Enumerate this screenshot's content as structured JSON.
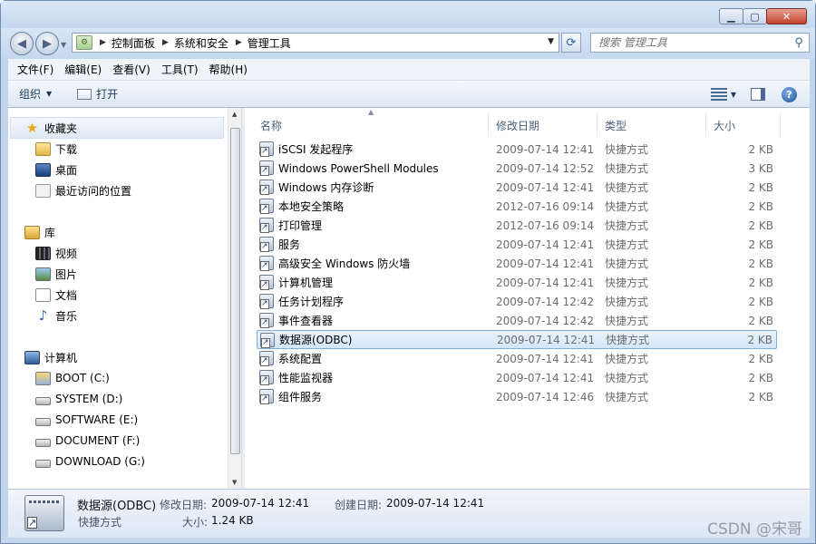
{
  "breadcrumb": [
    "控制面板",
    "系统和安全",
    "管理工具"
  ],
  "search": {
    "placeholder": "搜索 管理工具"
  },
  "menu": [
    "文件(F)",
    "编辑(E)",
    "查看(V)",
    "工具(T)",
    "帮助(H)"
  ],
  "commands": {
    "organize": "组织",
    "open": "打开"
  },
  "sidebar": {
    "favorites": {
      "label": "收藏夹",
      "items": [
        "下载",
        "桌面",
        "最近访问的位置"
      ]
    },
    "libraries": {
      "label": "库",
      "items": [
        "视频",
        "图片",
        "文档",
        "音乐"
      ]
    },
    "computer": {
      "label": "计算机",
      "drives": [
        "BOOT (C:)",
        "SYSTEM (D:)",
        "SOFTWARE (E:)",
        "DOCUMENT (F:)",
        "DOWNLOAD (G:)"
      ]
    }
  },
  "columns": {
    "name": "名称",
    "modified": "修改日期",
    "type": "类型",
    "size": "大小"
  },
  "files": [
    {
      "name": "iSCSI 发起程序",
      "date": "2009-07-14 12:41",
      "type": "快捷方式",
      "size": "2 KB"
    },
    {
      "name": "Windows PowerShell Modules",
      "date": "2009-07-14 12:52",
      "type": "快捷方式",
      "size": "3 KB"
    },
    {
      "name": "Windows 内存诊断",
      "date": "2009-07-14 12:41",
      "type": "快捷方式",
      "size": "2 KB"
    },
    {
      "name": "本地安全策略",
      "date": "2012-07-16 09:14",
      "type": "快捷方式",
      "size": "2 KB"
    },
    {
      "name": "打印管理",
      "date": "2012-07-16 09:14",
      "type": "快捷方式",
      "size": "2 KB"
    },
    {
      "name": "服务",
      "date": "2009-07-14 12:41",
      "type": "快捷方式",
      "size": "2 KB"
    },
    {
      "name": "高级安全 Windows 防火墙",
      "date": "2009-07-14 12:41",
      "type": "快捷方式",
      "size": "2 KB"
    },
    {
      "name": "计算机管理",
      "date": "2009-07-14 12:41",
      "type": "快捷方式",
      "size": "2 KB"
    },
    {
      "name": "任务计划程序",
      "date": "2009-07-14 12:42",
      "type": "快捷方式",
      "size": "2 KB"
    },
    {
      "name": "事件查看器",
      "date": "2009-07-14 12:42",
      "type": "快捷方式",
      "size": "2 KB"
    },
    {
      "name": "数据源(ODBC)",
      "date": "2009-07-14 12:41",
      "type": "快捷方式",
      "size": "2 KB"
    },
    {
      "name": "系统配置",
      "date": "2009-07-14 12:41",
      "type": "快捷方式",
      "size": "2 KB"
    },
    {
      "name": "性能监视器",
      "date": "2009-07-14 12:41",
      "type": "快捷方式",
      "size": "2 KB"
    },
    {
      "name": "组件服务",
      "date": "2009-07-14 12:46",
      "type": "快捷方式",
      "size": "2 KB"
    }
  ],
  "details": {
    "name": "数据源(ODBC)",
    "modified_label": "修改日期:",
    "modified": "2009-07-14 12:41",
    "created_label": "创建日期:",
    "created": "2009-07-14 12:41",
    "type": "快捷方式",
    "size_label": "大小:",
    "size": "1.24 KB"
  },
  "watermark": "CSDN @宋哥",
  "colors": {
    "selection": "#d3e6fb",
    "selection_border": "#84acdd",
    "chrome": "#c5d8ee"
  }
}
